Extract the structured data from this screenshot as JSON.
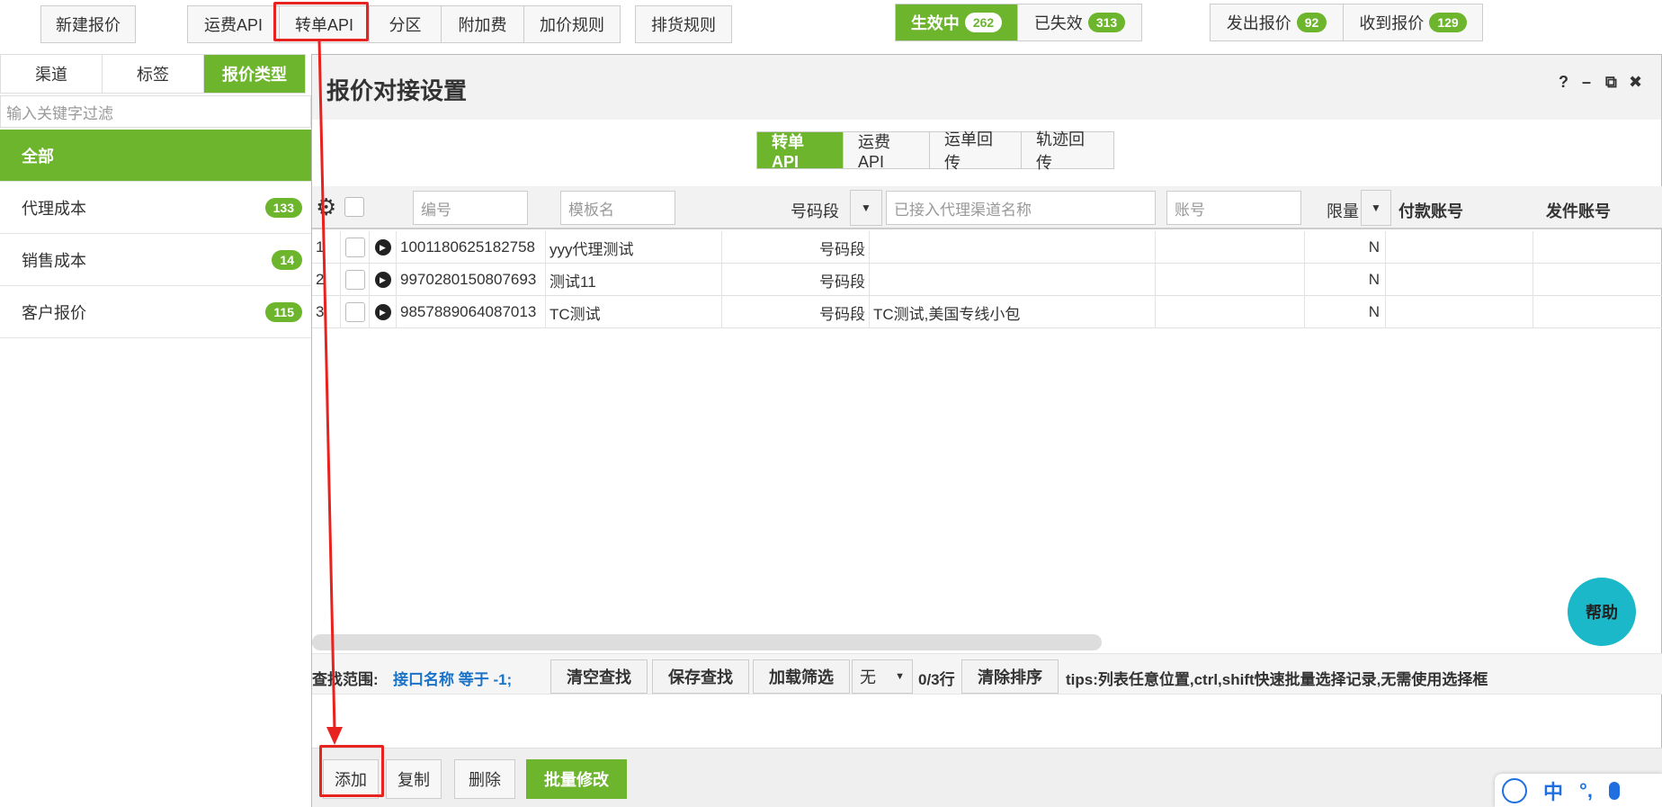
{
  "toolbar": {
    "new_quote": "新建报价",
    "tabs": [
      "运费API",
      "转单API",
      "分区",
      "附加费",
      "加价规则"
    ],
    "shipping_rule": "排货规则",
    "status": {
      "active_label": "生效中",
      "active_count": "262",
      "expired_label": "已失效",
      "expired_count": "313"
    },
    "quotes": {
      "sent_label": "发出报价",
      "sent_count": "92",
      "recv_label": "收到报价",
      "recv_count": "129"
    }
  },
  "sidebar": {
    "tabs": [
      "渠道",
      "标签",
      "报价类型"
    ],
    "filter_placeholder": "输入关键字过滤",
    "items": [
      {
        "label": "全部",
        "count": ""
      },
      {
        "label": "代理成本",
        "count": "133"
      },
      {
        "label": "销售成本",
        "count": "14"
      },
      {
        "label": "客户报价",
        "count": "115"
      }
    ]
  },
  "modal": {
    "title": "报价对接设置",
    "window_icons": [
      "?",
      "–",
      "⧉",
      "✖"
    ],
    "tabs": [
      "转单API",
      "运费API",
      "运单回传",
      "轨迹回传"
    ],
    "columns": {
      "code_placeholder": "编号",
      "template_placeholder": "模板名",
      "segment": "号码段",
      "channel_placeholder": "已接入代理渠道名称",
      "account_placeholder": "账号",
      "limit": "限量",
      "pay_account": "付款账号",
      "ship_account": "发件账号"
    },
    "rows": [
      {
        "n": "1",
        "code": "1001180625182758",
        "template": "yyy代理测试",
        "segment": "号码段",
        "channel": "",
        "limit": "N"
      },
      {
        "n": "2",
        "code": "9970280150807693",
        "template": "测试11",
        "segment": "号码段",
        "channel": "",
        "limit": "N"
      },
      {
        "n": "3",
        "code": "9857889064087013",
        "template": "TC测试",
        "segment": "号码段",
        "channel": "TC测试,美国专线小包",
        "limit": "N"
      }
    ],
    "search": {
      "scope_label": "查找范围:",
      "scope_value": "接口名称 等于 -1;",
      "clear": "清空查找",
      "save": "保存查找",
      "load": "加载筛选",
      "select_value": "无",
      "row_count": "0/3行",
      "clear_sort": "清除排序",
      "tips": "tips:列表任意位置,ctrl,shift快速批量选择记录,无需使用选择框"
    },
    "footer": {
      "add": "添加",
      "copy": "复制",
      "delete": "删除",
      "batch_edit": "批量修改"
    }
  },
  "help": "帮助",
  "ime": {
    "lang": "中",
    "punct": "°,"
  },
  "colors": {
    "accent": "#6cb52d",
    "highlight": "#e8231f",
    "help": "#1bb8c9"
  }
}
